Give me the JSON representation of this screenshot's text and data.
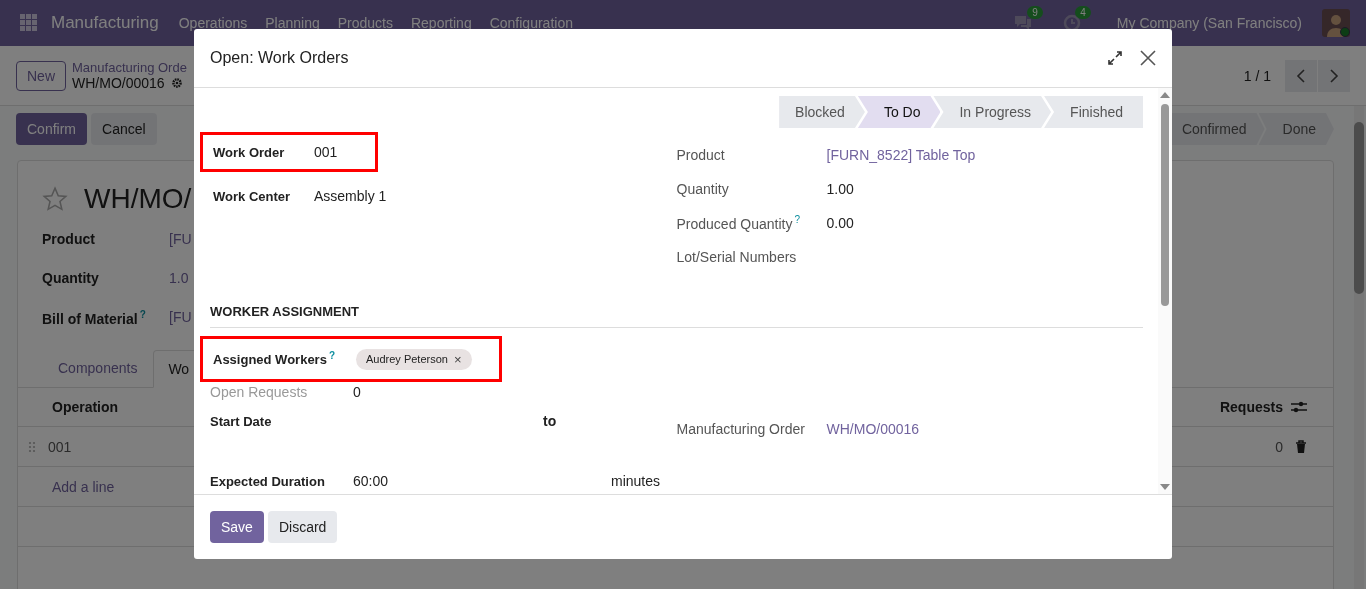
{
  "navbar": {
    "app_name": "Manufacturing",
    "menu": [
      "Operations",
      "Planning",
      "Products",
      "Reporting",
      "Configuration"
    ],
    "messages_count": "9",
    "activities_count": "4",
    "company": "My Company (San Francisco)"
  },
  "control_panel": {
    "new_button": "New",
    "breadcrumb": "Manufacturing Orde",
    "record": "WH/MO/00016",
    "pager": "1 / 1"
  },
  "actions": [
    "Confirm",
    "Cancel"
  ],
  "status_steps": [
    {
      "label": "Confirmed",
      "selected": false
    },
    {
      "label": "Done",
      "selected": false
    }
  ],
  "record": {
    "title": "WH/MO/",
    "starred": false,
    "fields": [
      {
        "label": "Product",
        "value": "[FU"
      },
      {
        "label": "Quantity",
        "value": "1.0"
      },
      {
        "label": "Bill of Material",
        "help": "?",
        "value": "[FU"
      }
    ]
  },
  "tabs": [
    {
      "label": "Components",
      "selected": false
    },
    {
      "label": "Wo",
      "selected": true
    }
  ],
  "table": {
    "columns": [
      "Operation",
      "Requests"
    ],
    "rows": [
      {
        "operation": "001",
        "requests": "0"
      }
    ],
    "add_line": "Add a line"
  },
  "dialog": {
    "title": "Open: Work Orders",
    "stages": [
      {
        "label": "Blocked",
        "selected": false
      },
      {
        "label": "To Do",
        "selected": true
      },
      {
        "label": "In Progress",
        "selected": false
      },
      {
        "label": "Finished",
        "selected": false
      }
    ],
    "left_fields": [
      {
        "label": "Work Order",
        "value": "001",
        "highlighted": true
      },
      {
        "label": "Work Center",
        "value": "Assembly 1",
        "highlighted": false
      }
    ],
    "right_fields": [
      {
        "label": "Product",
        "value": "[FURN_8522] Table Top",
        "kind": "link"
      },
      {
        "label": "Quantity",
        "value": "1.00",
        "kind": "text"
      },
      {
        "label": "Produced Quantity",
        "help": "?",
        "value": "0.00",
        "kind": "text"
      },
      {
        "label": "Lot/Serial Numbers"
      }
    ],
    "section": "WORKER ASSIGNMENT",
    "assigned_workers": {
      "label": "Assigned Workers",
      "help": "?",
      "highlighted": true,
      "tags": [
        {
          "label": "Audrey Peterson",
          "remove": "×"
        }
      ]
    },
    "open_requests": {
      "label": "Open Requests",
      "value": "0"
    },
    "start_date": {
      "label": "Start Date",
      "separator": "to"
    },
    "manufacturing_order": {
      "label": "Manufacturing Order",
      "value": "WH/MO/00016"
    },
    "expected_duration": {
      "label": "Expected Duration",
      "value": "60:00",
      "unit": "minutes"
    },
    "buttons": [
      "Save",
      "Discard"
    ]
  }
}
